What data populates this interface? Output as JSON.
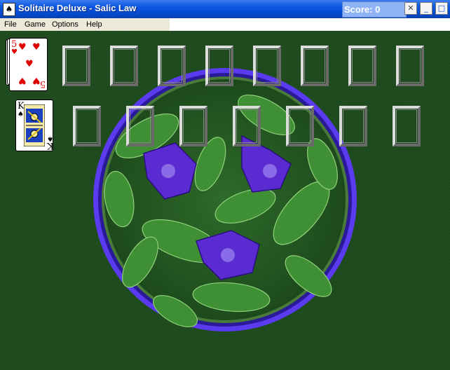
{
  "window": {
    "title": "Solitaire Deluxe - Salic Law",
    "score_label": "Score: 0",
    "app_icon_glyph": "♠",
    "minimize_glyph": "_",
    "maximize_glyph": "□",
    "close_glyph": "✕",
    "score_close_glyph": "✕"
  },
  "menu": {
    "items": [
      "File",
      "Game",
      "Options",
      "Help"
    ]
  },
  "cards": {
    "stock_top": {
      "rank": "5",
      "suit": "♥",
      "color": "#e00000"
    },
    "king": {
      "rank": "K",
      "suit": "♠",
      "color": "#000000"
    }
  },
  "board": {
    "foundation_rows": 2,
    "row1_slots": 8,
    "row2_slots": 7
  },
  "colors": {
    "felt": "#1f4d1f",
    "ring": "#4a2ad6",
    "title_bar": "#0548c9"
  }
}
